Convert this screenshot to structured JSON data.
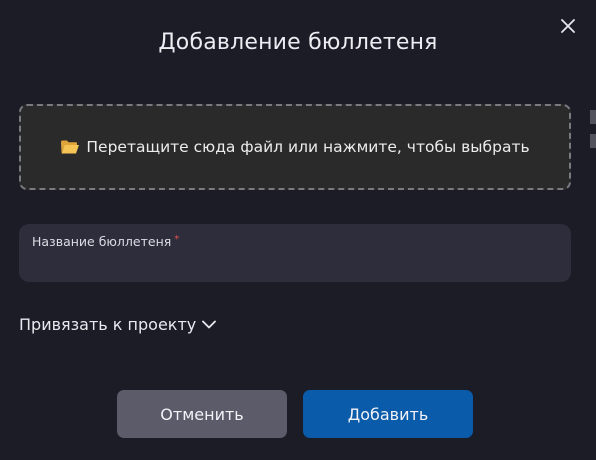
{
  "dialog": {
    "title": "Добавление бюллетеня",
    "close_icon": "close-icon"
  },
  "dropzone": {
    "icon": "folder-open-icon",
    "text": "Перетащите сюда файл или нажмите, чтобы выбрать"
  },
  "name_field": {
    "label": "Название бюллетеня",
    "required_mark": "*",
    "value": "",
    "placeholder": ""
  },
  "link_project": {
    "label": "Привязать к проекту",
    "icon": "chevron-down-icon"
  },
  "actions": {
    "cancel_label": "Отменить",
    "add_label": "Добавить"
  },
  "colors": {
    "background": "#1c1c26",
    "field_bg": "#2d2d3c",
    "dropzone_bg": "#2a2a2a",
    "cancel_bg": "#5c5b6a",
    "primary": "#0b5bab",
    "required": "#e05050"
  }
}
